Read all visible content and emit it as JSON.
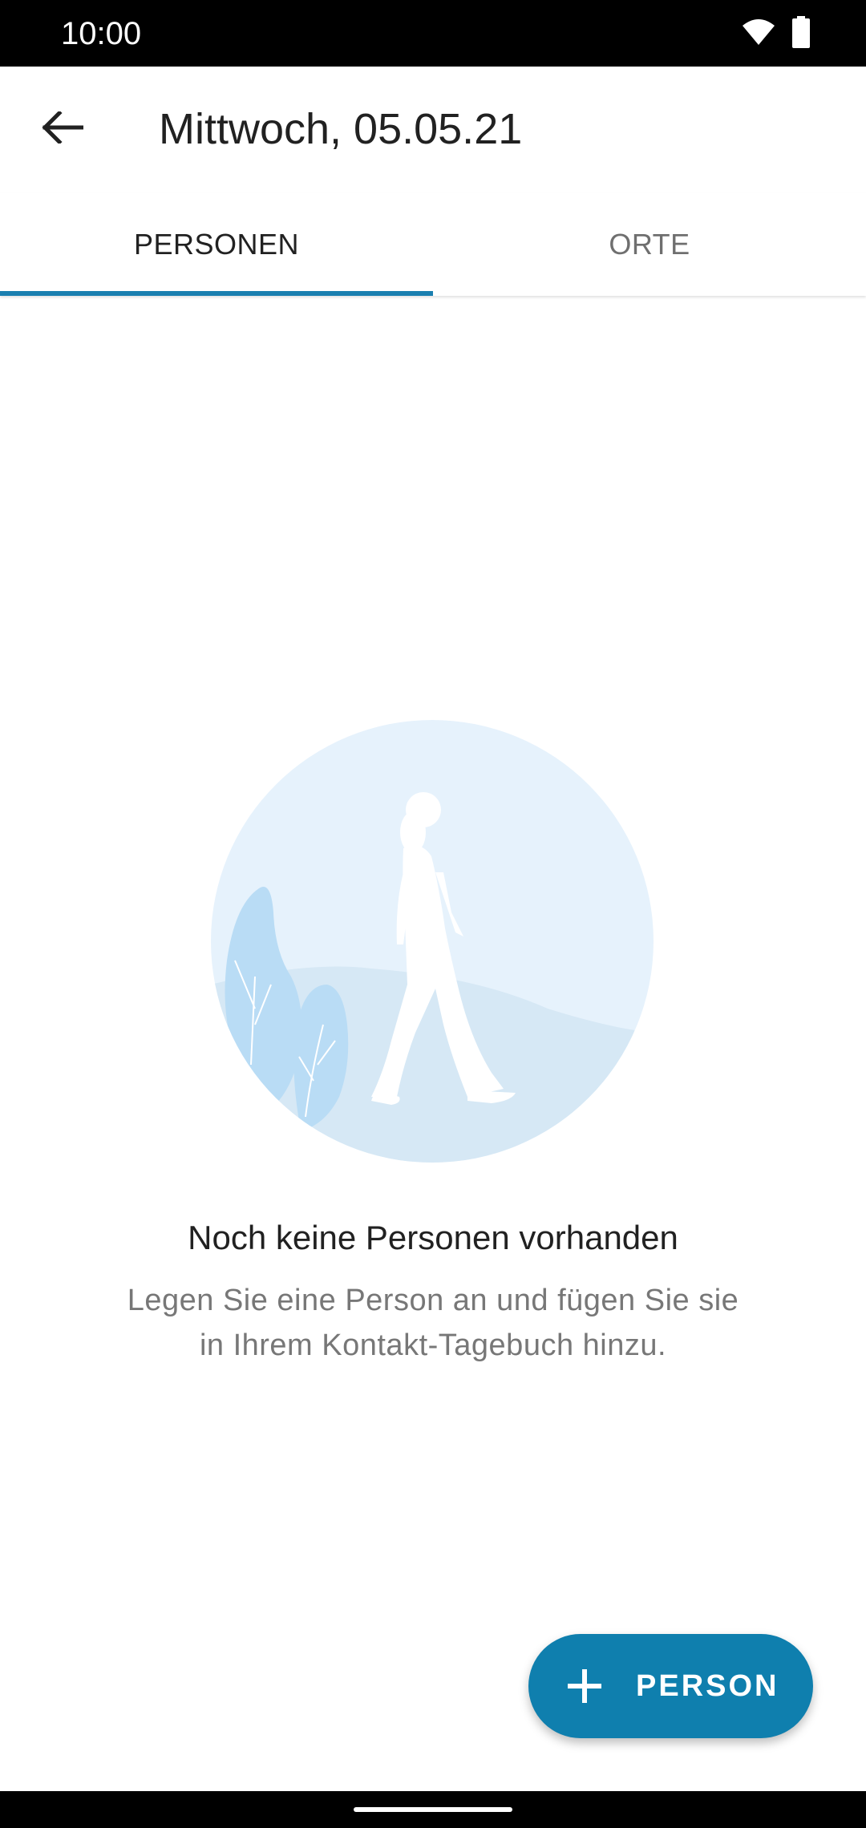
{
  "status_bar": {
    "time": "10:00",
    "icons": [
      "wifi-icon",
      "battery-icon"
    ]
  },
  "app_bar": {
    "back_icon": "arrow-back-icon",
    "title": "Mittwoch, 05.05.21"
  },
  "tabs": [
    {
      "label": "PERSONEN",
      "selected": true
    },
    {
      "label": "ORTE",
      "selected": false
    }
  ],
  "empty_state": {
    "illustration": "person-walking-illustration",
    "title": "Noch keine Personen vorhanden",
    "body": "Legen Sie eine Person an und fügen Sie sie in Ihrem Kontakt-Tagebuch hinzu."
  },
  "fab": {
    "icon": "plus-icon",
    "label": "PERSON"
  },
  "colors": {
    "accent": "#1a7fb0",
    "fab": "#0f7fae",
    "illustration_bg": "#e6f2fc",
    "illustration_hill": "#d6e8f5",
    "illustration_bush": "#b9dcf5"
  }
}
